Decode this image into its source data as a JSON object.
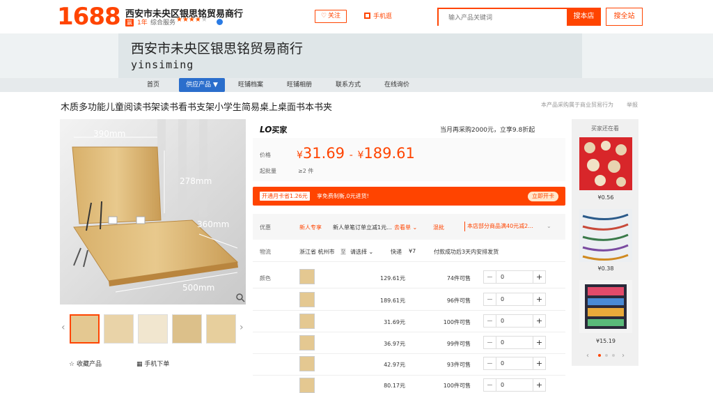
{
  "header": {
    "logo": "1688",
    "shop_name": "西安市未央区银思铭贸易商行",
    "years_badge": "赢",
    "years_text": "1年",
    "score_label": "综合服务",
    "follow_label": "关注",
    "mobile_label": "手机逛",
    "search_placeholder": "输入产品关键词",
    "search_store_label": "搜本店",
    "search_all_label": "搜全站"
  },
  "banner": {
    "title": "西安市未央区银思铭贸易商行",
    "subtitle": "yinsiming"
  },
  "nav": {
    "items": [
      "首页",
      "供应产品 ▼",
      "旺铺档案",
      "旺铺相册",
      "联系方式",
      "在线询价"
    ]
  },
  "product": {
    "title": "木质多功能儿童阅读书架读书看书支架小学生简易桌上桌面书本书夹",
    "trade_note": "本产品采购属于商业贸易行为",
    "report_label": "举报",
    "image_labels": {
      "width_top": "390mm",
      "height": "278mm",
      "depth": "360mm",
      "width_bottom": "500mm"
    },
    "fav_label": "收藏产品",
    "order_label": "手机下单"
  },
  "purchase": {
    "lo_brand": "LO",
    "lo_sub": "买家",
    "promo": "当月再采购2000元，立享9.8折起",
    "price_label": "价格",
    "price_low": "31.69",
    "price_high": "189.61",
    "currency": "¥",
    "price_sep": "-",
    "moq_label": "起批量",
    "moq_value": "≥2 件",
    "vip_tag": "开通月卡省1.26元",
    "vip_text": "享免费制衡,0元进货!",
    "vip_btn": "立即开卡",
    "discount_label": "优惠",
    "disc_newbie": "新人专享",
    "disc_text": "新人单笔订单立减1元...",
    "disc_coupon": "去看单 ⌄",
    "disc_mix": "混批",
    "disc_store": "本店部分商品满40元减2...",
    "ship_label": "物流",
    "ship_from": "浙江省 杭州市",
    "ship_to_label": "至",
    "ship_to": "请选择 ⌄",
    "ship_method": "快递",
    "ship_fee": "¥7",
    "ship_note": "付款成功后3天内安排发货",
    "color_label": "颜色"
  },
  "skus": [
    {
      "price": "129.61元",
      "stock": "74件可售",
      "qty": "0"
    },
    {
      "price": "189.61元",
      "stock": "96件可售",
      "qty": "0"
    },
    {
      "price": "31.69元",
      "stock": "100件可售",
      "qty": "0"
    },
    {
      "price": "36.97元",
      "stock": "99件可售",
      "qty": "0"
    },
    {
      "price": "42.97元",
      "stock": "93件可售",
      "qty": "0"
    },
    {
      "price": "80.17元",
      "stock": "100件可售",
      "qty": "0"
    }
  ],
  "sidebar": {
    "title": "买家还在看",
    "items": [
      {
        "price": "¥0.56"
      },
      {
        "price": "¥0.38"
      },
      {
        "price": "¥15.19"
      }
    ]
  },
  "colors": {
    "accent": "#ff4400",
    "nav_active": "#2b6ecc"
  }
}
